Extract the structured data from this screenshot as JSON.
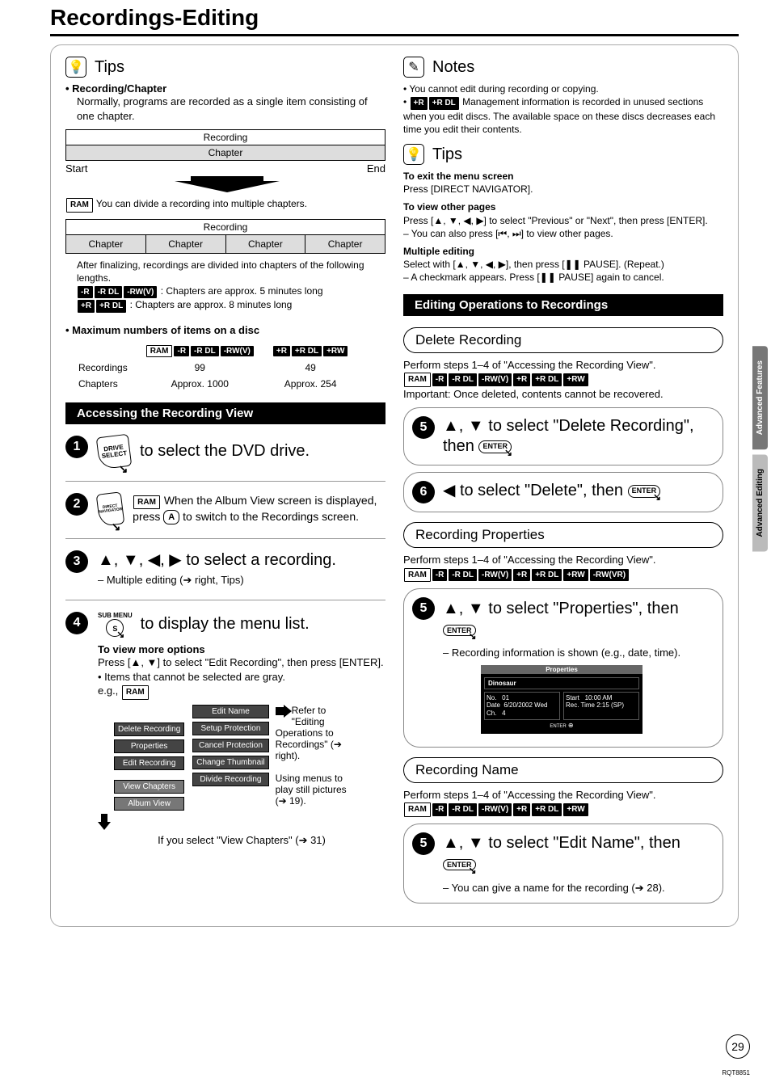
{
  "page": {
    "title": "Recordings-Editing",
    "number": "29",
    "doc_code": "RQT8851"
  },
  "side_tabs": {
    "upper": "Advanced Features",
    "lower": "Advanced Editing"
  },
  "tips": {
    "heading": "Tips",
    "rc_title": "• Recording/Chapter",
    "rc_body": "Normally, programs are recorded as a single item consisting of one chapter.",
    "diagram": {
      "recording": "Recording",
      "chapter": "Chapter",
      "start": "Start",
      "end": "End"
    },
    "ram_divide": " You can divide a recording into multiple chapters.",
    "finalize": "After finalizing, recordings are divided into chapters of the following lengths.",
    "len5": " : Chapters are approx. 5 minutes long",
    "len8": " : Chapters are approx. 8 minutes long",
    "max_title": "• Maximum numbers of items on a disc",
    "table": {
      "row1": "Recordings",
      "row2": "Chapters",
      "colA_rec": "99",
      "colA_ch": "Approx. 1000",
      "colB_rec": "49",
      "colB_ch": "Approx. 254"
    }
  },
  "accessing": {
    "bar": "Accessing the Recording View",
    "step1": {
      "btn": "DRIVE\nSELECT",
      "text": " to select the DVD drive."
    },
    "step2": {
      "btn": "DIRECT NAVIGATOR",
      "text_pre": " When the Album View screen is displayed, press ",
      "key": "A",
      "text_post": " to switch to the Recordings screen."
    },
    "step3": {
      "text": "▲, ▼, ◀, ▶ to select a recording.",
      "note": "– Multiple editing (➔ right, Tips)"
    },
    "step4": {
      "btn": "SUB MENU",
      "key": "S",
      "text": " to display the menu list.",
      "more_title": "To view more options",
      "more_body": "Press [▲, ▼] to select \"Edit Recording\", then press [ENTER].",
      "gray": "• Items that cannot be selected are gray.",
      "eg": "e.g., ",
      "menu_left": [
        "Delete Recording",
        "Properties",
        "Edit Recording",
        "View Chapters",
        "Album View"
      ],
      "menu_right": [
        "Edit Name",
        "Setup Protection",
        "Cancel Protection",
        "Change Thumbnail",
        "Divide Recording"
      ],
      "refer": "Refer to \"Editing Operations to Recordings\" (➔ right).",
      "using": "Using menus to play still pictures (➔ 19).",
      "vc": "If you select \"View Chapters\" (➔ 31)"
    }
  },
  "notes": {
    "heading": "Notes",
    "n1": "• You cannot edit during recording or copying.",
    "n2_post": " Management information is recorded in unused sections when you edit discs. The available space on these discs decreases each time you edit their contents."
  },
  "tips2": {
    "heading": "Tips",
    "exit_title": "To exit the menu screen",
    "exit_body": "Press [DIRECT NAVIGATOR].",
    "other_title": "To view other pages",
    "other_body": "Press [▲, ▼, ◀, ▶] to select \"Previous\" or \"Next\", then press [ENTER].",
    "other_body2": "– You can also press [⏮, ⏭] to view other pages.",
    "multi_title": "Multiple editing",
    "multi_body": "Select with [▲, ▼, ◀, ▶], then press [❚❚ PAUSE]. (Repeat.)",
    "multi_body2": "– A checkmark appears. Press [❚❚ PAUSE] again to cancel."
  },
  "editing_bar": "Editing Operations to Recordings",
  "delete": {
    "head": "Delete Recording",
    "lead": "Perform steps 1–4 of \"Accessing the Recording View\".",
    "important": "Important: Once deleted, contents cannot be recovered.",
    "step5": "▲, ▼ to select \"Delete Recording\", then ",
    "step6": "◀ to select \"Delete\", then "
  },
  "properties": {
    "head": "Recording Properties",
    "lead": "Perform steps 1–4 of \"Accessing the Recording View\".",
    "step5": "▲, ▼ to select \"Properties\", then",
    "note": "– Recording information is shown (e.g., date, time).",
    "win": {
      "title": "Properties",
      "name": "Dinosaur",
      "l1": "No.",
      "l1v": "01",
      "r1": "Start",
      "r1v": "10:00 AM",
      "l2": "Date",
      "l2v": "6/20/2002 Wed",
      "r2": "Rec. Time 2:15 (SP)",
      "l3": "Ch.",
      "l3v": "4",
      "enter": "ENTER"
    }
  },
  "rename": {
    "head": "Recording Name",
    "lead": "Perform steps 1–4 of \"Accessing the Recording View\".",
    "step5": "▲, ▼ to select \"Edit Name\", then",
    "note": "– You can give a name for the recording (➔ 28)."
  },
  "formats": {
    "ram": "RAM",
    "r": "-R",
    "rdl": "-R DL",
    "rwv": "-RW(V)",
    "pr": "+R",
    "prdl": "+R DL",
    "prw": "+RW",
    "rwvr": "-RW(VR)"
  },
  "keys": {
    "enter": "ENTER"
  }
}
